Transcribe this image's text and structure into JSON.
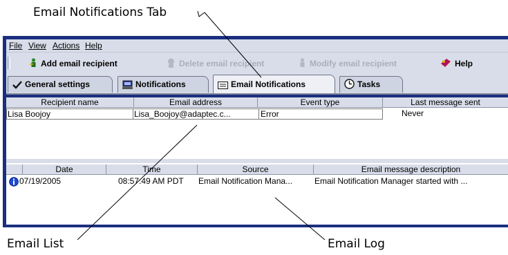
{
  "callouts": {
    "tab": "Email Notifications Tab",
    "list": "Email List",
    "log": "Email Log"
  },
  "menu": {
    "file": "File",
    "view": "View",
    "actions": "Actions",
    "help": "Help"
  },
  "toolbar": {
    "add": "Add email recipient",
    "delete": "Delete email recipient",
    "modify": "Modify email recipient",
    "help": "Help"
  },
  "tabs": {
    "general": "General settings",
    "notifications": "Notifications",
    "email": "Email Notifications",
    "tasks": "Tasks"
  },
  "recipients": {
    "headers": [
      "Recipient name",
      "Email address",
      "Event type",
      "Last message sent"
    ],
    "rows": [
      {
        "name": "Lisa Boojoy",
        "email": "Lisa_Boojoy@adaptec.c...",
        "event": "Error",
        "last": "Never"
      }
    ]
  },
  "log": {
    "headers": [
      "Date",
      "Time",
      "Source",
      "Email message description"
    ],
    "rows": [
      {
        "icon": "info-icon",
        "date": "07/19/2005",
        "time": "08:57:49 AM PDT",
        "source": "Email Notification Mana...",
        "description": "Email Notification Manager started with ..."
      }
    ]
  },
  "colors": {
    "frame": "#1a2f80",
    "chrome": "#d9dde9",
    "disabled": "#a9aebd"
  }
}
